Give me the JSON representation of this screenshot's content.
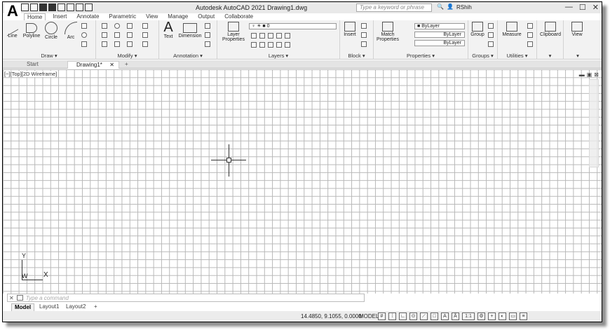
{
  "app": {
    "logo": "A",
    "title": "Autodesk AutoCAD 2021   Drawing1.dwg",
    "search_placeholder": "Type a keyword or phrase",
    "user": "RShih"
  },
  "ribbon_tabs": [
    "Home",
    "Insert",
    "Annotate",
    "Parametric",
    "View",
    "Manage",
    "Output",
    "Collaborate"
  ],
  "ribbon": {
    "draw": {
      "title": "Draw ▾",
      "tools": [
        "Line",
        "Polyline",
        "Circle",
        "Arc"
      ]
    },
    "modify": {
      "title": "Modify ▾"
    },
    "annotation": {
      "title": "Annotation ▾",
      "tools": [
        "Text",
        "Dimension"
      ]
    },
    "layers": {
      "title": "Layers ▾",
      "layer_properties": "Layer Properties",
      "current_layer": "0"
    },
    "block": {
      "title": "Block ▾",
      "insert": "Insert"
    },
    "properties": {
      "title": "Properties ▾",
      "match": "Match Properties",
      "color": "ByLayer",
      "linetype": "ByLayer",
      "lineweight": "ByLayer"
    },
    "groups": {
      "title": "Groups ▾",
      "group": "Group"
    },
    "utilities": {
      "title": "Utilities ▾",
      "measure": "Measure"
    },
    "clipboard": {
      "label": "Clipboard"
    },
    "view": {
      "label": "View"
    }
  },
  "file_tabs": {
    "start": "Start",
    "drawing": "Drawing1*",
    "close": "✕",
    "add": "+"
  },
  "viewport": {
    "label": "[−][Top][2D Wireframe]"
  },
  "ucs": {
    "y": "Y",
    "w": "W",
    "x": "X"
  },
  "command": {
    "close": "✕",
    "placeholder": "Type a command"
  },
  "layout_tabs": [
    "Model",
    "Layout1",
    "Layout2"
  ],
  "layout_add": "+",
  "status": {
    "coords": "14.4850, 9.1055, 0.0000",
    "model": "MODEL",
    "scale": "1:1"
  }
}
